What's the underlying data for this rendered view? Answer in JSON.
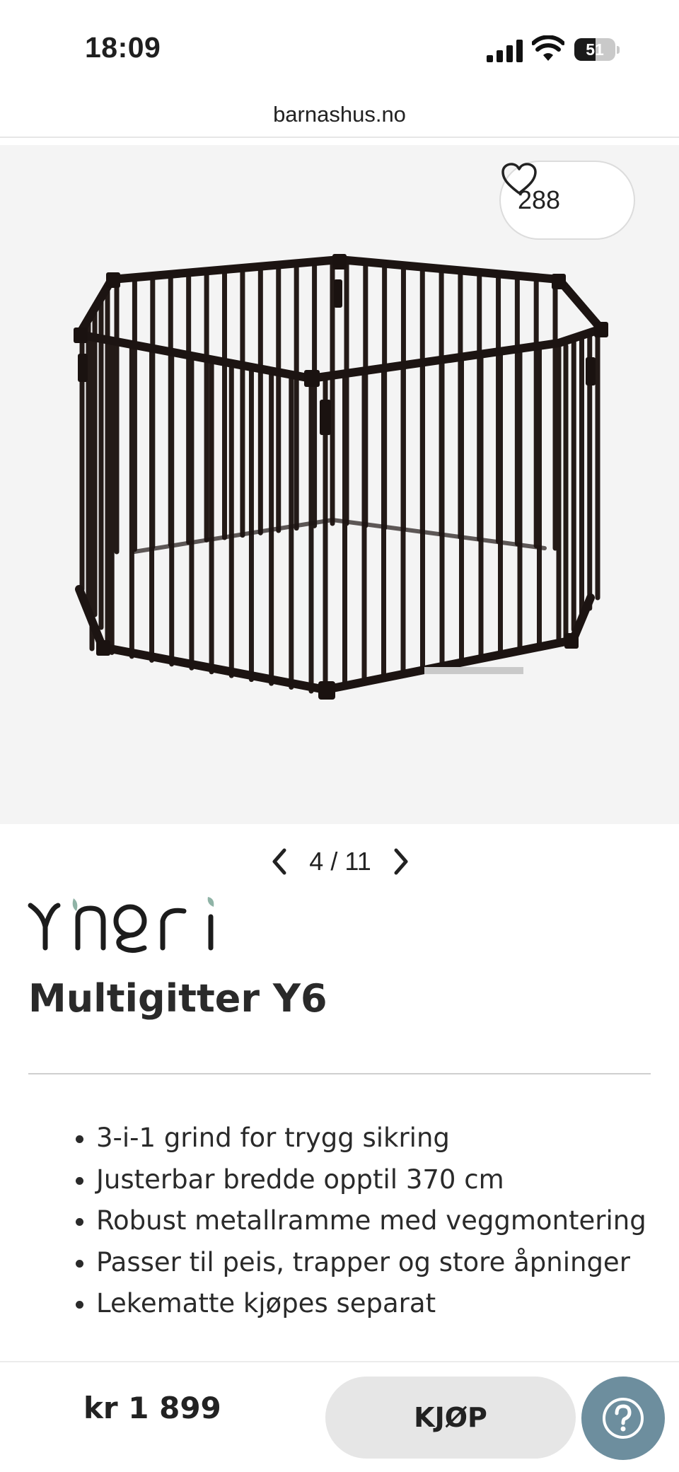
{
  "status_bar": {
    "time": "18:09",
    "battery_level": "51",
    "battery_fraction": 0.51,
    "icons": [
      "cellular-signal-icon",
      "wifi-icon",
      "battery-icon"
    ]
  },
  "browser": {
    "url": "barnashus.no"
  },
  "gallery": {
    "like_count": "288",
    "current": "4",
    "total": "11",
    "separator": "/",
    "icons": [
      "heart-icon",
      "chevron-left-icon",
      "chevron-right-icon"
    ]
  },
  "product": {
    "brand": "Yngri",
    "title": "Multigitter Y6",
    "features": [
      "3-i-1 grind for trygg sikring",
      "Justerbar bredde opptil 370 cm",
      "Robust metallramme med veggmontering",
      "Passer til peis, trapper og store åpninger",
      "Lekematte kjøpes separat"
    ],
    "price": "kr 1 899",
    "buy_label": "KJØP"
  },
  "colors": {
    "brand_leaf": "#8fb3a6",
    "help_button": "#6d8e9e",
    "buy_button": "#e6e6e6",
    "image_background": "#f4f4f4"
  },
  "help": {
    "icon": "question-mark-icon"
  }
}
